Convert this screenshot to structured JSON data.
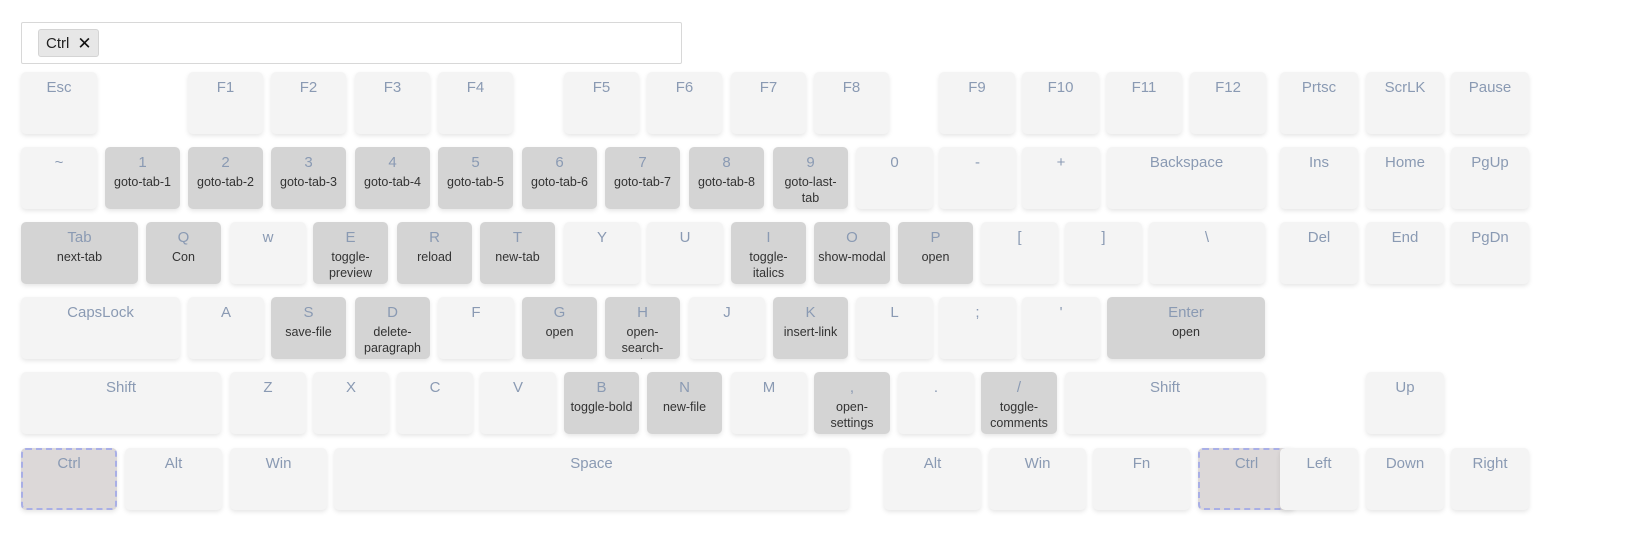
{
  "search": {
    "chips": [
      {
        "label": "Ctrl",
        "remove_icon": "close-icon"
      }
    ]
  },
  "colors": {
    "key_bg": "#f4f4f4",
    "bound_key_bg": "#d4d4d4",
    "active_key_bg": "#dcd8d8",
    "active_border": "#a9afe6",
    "key_label": "#8a9ab3",
    "action_text": "#333333"
  },
  "keyboard": {
    "rows": [
      [
        {
          "id": "esc",
          "label": "Esc"
        },
        {
          "id": "f1",
          "label": "F1"
        },
        {
          "id": "f2",
          "label": "F2"
        },
        {
          "id": "f3",
          "label": "F3"
        },
        {
          "id": "f4",
          "label": "F4"
        },
        {
          "id": "f5",
          "label": "F5"
        },
        {
          "id": "f6",
          "label": "F6"
        },
        {
          "id": "f7",
          "label": "F7"
        },
        {
          "id": "f8",
          "label": "F8"
        },
        {
          "id": "f9",
          "label": "F9"
        },
        {
          "id": "f10",
          "label": "F10"
        },
        {
          "id": "f11",
          "label": "F11"
        },
        {
          "id": "f12",
          "label": "F12"
        },
        {
          "id": "prtsc",
          "label": "Prtsc"
        },
        {
          "id": "scrlk",
          "label": "ScrLK"
        },
        {
          "id": "pause",
          "label": "Pause"
        }
      ],
      [
        {
          "id": "tilde",
          "label": "~"
        },
        {
          "id": "1",
          "label": "1",
          "action": "goto-tab-1"
        },
        {
          "id": "2",
          "label": "2",
          "action": "goto-tab-2"
        },
        {
          "id": "3",
          "label": "3",
          "action": "goto-tab-3"
        },
        {
          "id": "4",
          "label": "4",
          "action": "goto-tab-4"
        },
        {
          "id": "5",
          "label": "5",
          "action": "goto-tab-5"
        },
        {
          "id": "6",
          "label": "6",
          "action": "goto-tab-6"
        },
        {
          "id": "7",
          "label": "7",
          "action": "goto-tab-7"
        },
        {
          "id": "8",
          "label": "8",
          "action": "goto-tab-8"
        },
        {
          "id": "9",
          "label": "9",
          "action": "goto-last-tab"
        },
        {
          "id": "0",
          "label": "0"
        },
        {
          "id": "minus",
          "label": "-"
        },
        {
          "id": "plus",
          "label": "+"
        },
        {
          "id": "backspace",
          "label": "Backspace"
        },
        {
          "id": "ins",
          "label": "Ins"
        },
        {
          "id": "home",
          "label": "Home"
        },
        {
          "id": "pgup",
          "label": "PgUp"
        }
      ],
      [
        {
          "id": "tab",
          "label": "Tab",
          "action": "next-tab"
        },
        {
          "id": "q",
          "label": "Q",
          "action": "Con"
        },
        {
          "id": "w",
          "label": "w"
        },
        {
          "id": "e",
          "label": "E",
          "action": "toggle-preview"
        },
        {
          "id": "r",
          "label": "R",
          "action": "reload"
        },
        {
          "id": "t",
          "label": "T",
          "action": "new-tab"
        },
        {
          "id": "y",
          "label": "Y"
        },
        {
          "id": "u",
          "label": "U"
        },
        {
          "id": "i",
          "label": "I",
          "action": "toggle-italics"
        },
        {
          "id": "o",
          "label": "O",
          "action": "show-modal"
        },
        {
          "id": "p",
          "label": "P",
          "action": "open"
        },
        {
          "id": "lbracket",
          "label": "["
        },
        {
          "id": "rbracket",
          "label": "]"
        },
        {
          "id": "backslash",
          "label": "\\"
        },
        {
          "id": "del",
          "label": "Del"
        },
        {
          "id": "end",
          "label": "End"
        },
        {
          "id": "pgdn",
          "label": "PgDn"
        }
      ],
      [
        {
          "id": "capslock",
          "label": "CapsLock"
        },
        {
          "id": "a",
          "label": "A"
        },
        {
          "id": "s",
          "label": "S",
          "action": "save-file"
        },
        {
          "id": "d",
          "label": "D",
          "action": "delete-paragraph"
        },
        {
          "id": "f",
          "label": "F"
        },
        {
          "id": "g",
          "label": "G",
          "action": "open"
        },
        {
          "id": "h",
          "label": "H",
          "action": "open-search-replace"
        },
        {
          "id": "j",
          "label": "J"
        },
        {
          "id": "k",
          "label": "K",
          "action": "insert-link"
        },
        {
          "id": "l",
          "label": "L"
        },
        {
          "id": "semicolon",
          "label": ";"
        },
        {
          "id": "quote",
          "label": "'"
        },
        {
          "id": "enter",
          "label": "Enter",
          "action": "open"
        }
      ],
      [
        {
          "id": "lshift",
          "label": "Shift"
        },
        {
          "id": "z",
          "label": "Z"
        },
        {
          "id": "x",
          "label": "X"
        },
        {
          "id": "c",
          "label": "C"
        },
        {
          "id": "v",
          "label": "V"
        },
        {
          "id": "b",
          "label": "B",
          "action": "toggle-bold"
        },
        {
          "id": "n",
          "label": "N",
          "action": "new-file"
        },
        {
          "id": "m",
          "label": "M"
        },
        {
          "id": "comma",
          "label": ",",
          "action": "open-settings"
        },
        {
          "id": "period",
          "label": "."
        },
        {
          "id": "slash",
          "label": "/",
          "action": "toggle-comments"
        },
        {
          "id": "rshift",
          "label": "Shift"
        },
        {
          "id": "up",
          "label": "Up"
        }
      ],
      [
        {
          "id": "lctrl",
          "label": "Ctrl",
          "active": true
        },
        {
          "id": "lalt",
          "label": "Alt"
        },
        {
          "id": "lwin",
          "label": "Win"
        },
        {
          "id": "space",
          "label": "Space"
        },
        {
          "id": "ralt",
          "label": "Alt"
        },
        {
          "id": "rwin",
          "label": "Win"
        },
        {
          "id": "fn",
          "label": "Fn"
        },
        {
          "id": "rctrl",
          "label": "Ctrl",
          "active": true
        },
        {
          "id": "left",
          "label": "Left"
        },
        {
          "id": "down",
          "label": "Down"
        },
        {
          "id": "right",
          "label": "Right"
        }
      ]
    ]
  }
}
